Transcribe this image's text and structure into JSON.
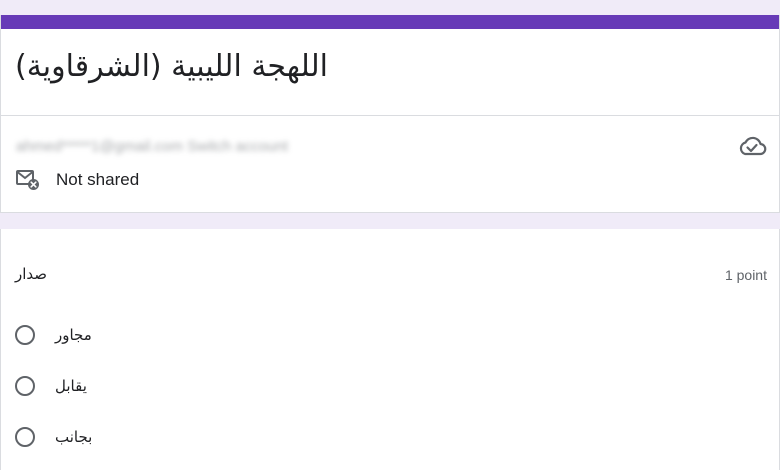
{
  "form": {
    "title": "اللهجة الليبية (الشرقاوية)",
    "accent_color": "#673ab7",
    "background_color": "#f0ebf8"
  },
  "account": {
    "email": "ahmed*****1@gmail.com Switch account",
    "status_icon": "cloud-check-icon",
    "not_shared_icon": "mail-not-shared-icon",
    "not_shared_label": "Not shared"
  },
  "question": {
    "text": "صدار",
    "points": "1 point",
    "options": [
      {
        "label": "مجاور",
        "selected": false
      },
      {
        "label": "يقابل",
        "selected": false
      },
      {
        "label": "بجانب",
        "selected": false
      }
    ]
  }
}
